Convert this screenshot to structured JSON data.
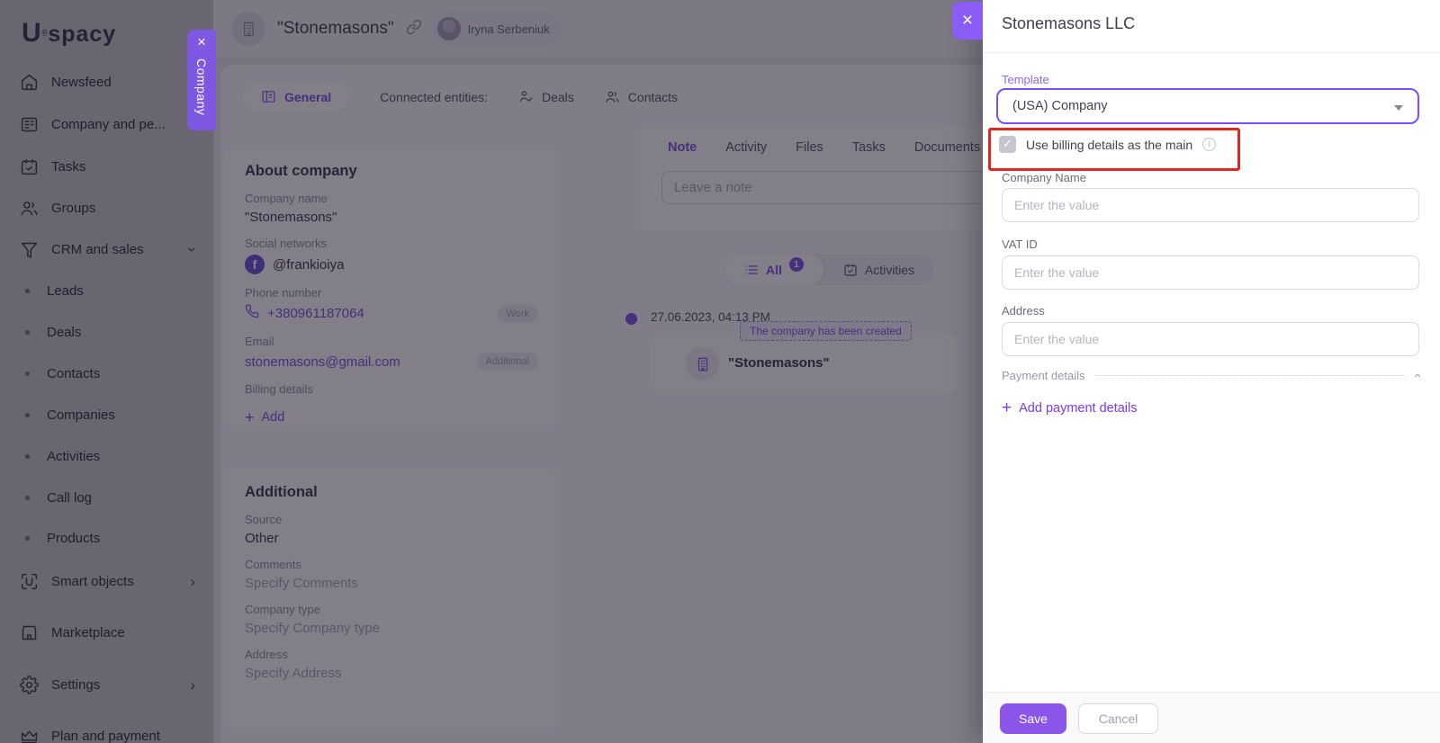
{
  "brand": {
    "logo_u": "U",
    "logo_rest": "spacy"
  },
  "sidebar": {
    "items": [
      {
        "label": "Newsfeed"
      },
      {
        "label": "Company and pe..."
      },
      {
        "label": "Tasks"
      },
      {
        "label": "Groups"
      },
      {
        "label": "CRM and sales"
      },
      {
        "label": "Leads"
      },
      {
        "label": "Deals"
      },
      {
        "label": "Contacts"
      },
      {
        "label": "Companies"
      },
      {
        "label": "Activities"
      },
      {
        "label": "Call log"
      },
      {
        "label": "Products"
      },
      {
        "label": "Smart objects"
      },
      {
        "label": "Marketplace"
      },
      {
        "label": "Settings"
      },
      {
        "label": "Plan and payment"
      }
    ]
  },
  "header": {
    "company_title": "\"Stonemasons\"",
    "owner_name": "Iryna Serbeniuk"
  },
  "entity_tabs": {
    "general": "General",
    "connected": "Connected entities:",
    "deals": "Deals",
    "contacts": "Contacts"
  },
  "about": {
    "title": "About company",
    "company_name_label": "Company name",
    "company_name": "\"Stonemasons\"",
    "social_label": "Social networks",
    "social_value": "@frankioiya",
    "phone_label": "Phone number",
    "phone_value": "+380961187064",
    "phone_badge": "Work",
    "email_label": "Email",
    "email_value": "stonemasons@gmail.com",
    "email_badge": "Additional",
    "billing_label": "Billing details",
    "add_label": "Add"
  },
  "additional": {
    "title": "Additional",
    "source_label": "Source",
    "source_value": "Other",
    "comments_label": "Comments",
    "comments_placeholder": "Specify Comments",
    "type_label": "Company type",
    "type_placeholder": "Specify Company type",
    "address_label": "Address",
    "address_placeholder": "Specify Address"
  },
  "note_card": {
    "tab_note": "Note",
    "tab_activity": "Activity",
    "tab_files": "Files",
    "tab_tasks": "Tasks",
    "tab_documents": "Documents",
    "note_placeholder": "Leave a note"
  },
  "feed": {
    "all_label": "All",
    "all_count": "1",
    "activities_label": "Activities",
    "event_date": "27.06.2023, 04:13 PM",
    "event_badge": "The company has been created",
    "event_company": "\"Stonemasons\""
  },
  "company_side_tab": {
    "label": "Company"
  },
  "drawer": {
    "title": "Stonemasons LLC",
    "template_label": "Template",
    "template_value": "(USA) Company",
    "checkbox_label": "Use billing details as the main",
    "fields": [
      {
        "label": "Company Name",
        "placeholder": "Enter the value"
      },
      {
        "label": "VAT ID",
        "placeholder": "Enter the value"
      },
      {
        "label": "Address",
        "placeholder": "Enter the value"
      }
    ],
    "payment_section_label": "Payment details",
    "add_payment_label": "Add payment details",
    "save_label": "Save",
    "cancel_label": "Cancel"
  },
  "colors": {
    "accent_purple": "#7C4DFF",
    "button_purple": "#8B55EA",
    "highlight_red": "#E3261D"
  }
}
